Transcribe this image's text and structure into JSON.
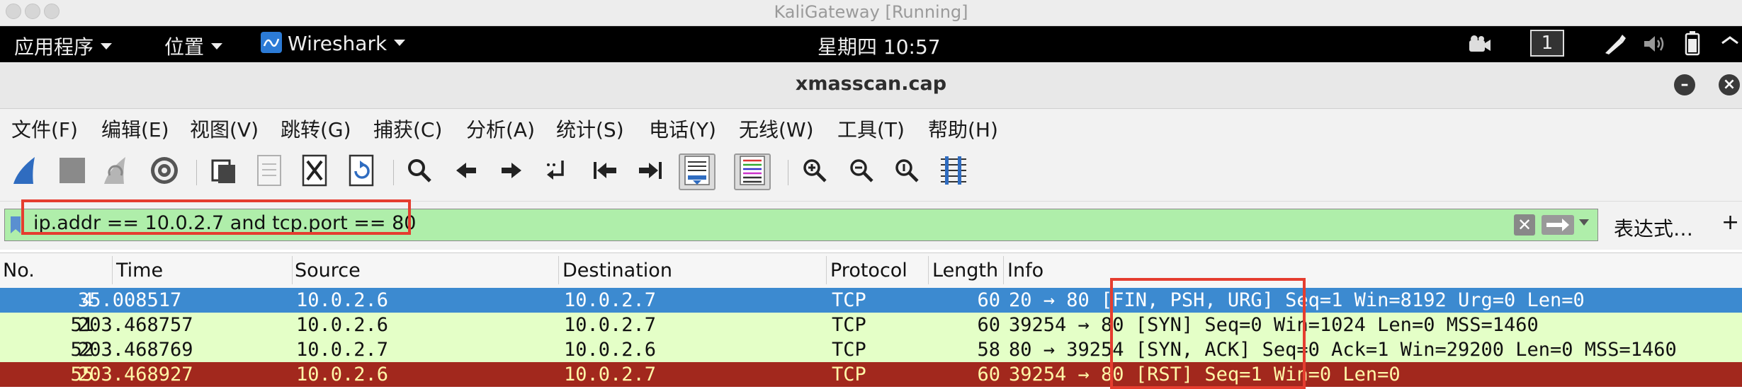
{
  "vm_window": {
    "title": "KaliGateway [Running]"
  },
  "gnome_bar": {
    "apps_menu": "应用程序",
    "places_menu": "位置",
    "app_menu": "Wireshark",
    "clock": "星期四 10:57",
    "workspace": "1"
  },
  "app_window": {
    "title": "xmasscan.cap"
  },
  "menu": {
    "items": [
      "文件(F)",
      "编辑(E)",
      "视图(V)",
      "跳转(G)",
      "捕获(C)",
      "分析(A)",
      "统计(S)",
      "电话(Y)",
      "无线(W)",
      "工具(T)",
      "帮助(H)"
    ]
  },
  "toolbar": {
    "icons": [
      "shark-fin-start-icon",
      "stop-square-icon",
      "restart-fin-icon",
      "capture-options-gear-icon",
      "open-file-icon",
      "save-file-icon",
      "close-file-icon",
      "reload-file-icon",
      "find-packet-icon",
      "go-back-icon",
      "go-forward-icon",
      "go-to-packet-icon",
      "go-first-icon",
      "go-last-icon",
      "auto-scroll-icon",
      "colorize-icon",
      "zoom-in-icon",
      "zoom-out-icon",
      "zoom-normal-icon",
      "resize-columns-icon"
    ]
  },
  "filter": {
    "value": "ip.addr == 10.0.2.7 and tcp.port == 80",
    "expression_label": "表达式…",
    "add_label": "+",
    "bg_color": "#afeeaa"
  },
  "packet_list": {
    "headers": {
      "no": "No.",
      "time": "Time",
      "source": "Source",
      "destination": "Destination",
      "protocol": "Protocol",
      "length": "Length",
      "info": "Info"
    },
    "rows": [
      {
        "no": "4",
        "time": "35.008517",
        "source": "10.0.2.6",
        "destination": "10.0.2.7",
        "protocol": "TCP",
        "length": "60",
        "info": "20 → 80 [FIN, PSH, URG] Seq=1 Win=8192 Urg=0 Len=0"
      },
      {
        "no": "51",
        "time": "203.468757",
        "source": "10.0.2.6",
        "destination": "10.0.2.7",
        "protocol": "TCP",
        "length": "60",
        "info": "39254 → 80 [SYN] Seq=0 Win=1024 Len=0 MSS=1460"
      },
      {
        "no": "52",
        "time": "203.468769",
        "source": "10.0.2.7",
        "destination": "10.0.2.6",
        "protocol": "TCP",
        "length": "58",
        "info": "80 → 39254 [SYN, ACK] Seq=0 Ack=1 Win=29200 Len=0 MSS=1460"
      },
      {
        "no": "55",
        "time": "203.468927",
        "source": "10.0.2.6",
        "destination": "10.0.2.7",
        "protocol": "TCP",
        "length": "60",
        "info": "39254 → 80 [RST] Seq=1 Win=0 Len=0"
      }
    ],
    "row_colors": {
      "selected": "#3c8ad0",
      "tcp": "#e4ffc7",
      "rst": "#a2281d"
    }
  },
  "annotations": {
    "highlight_color": "#e53d2f"
  }
}
